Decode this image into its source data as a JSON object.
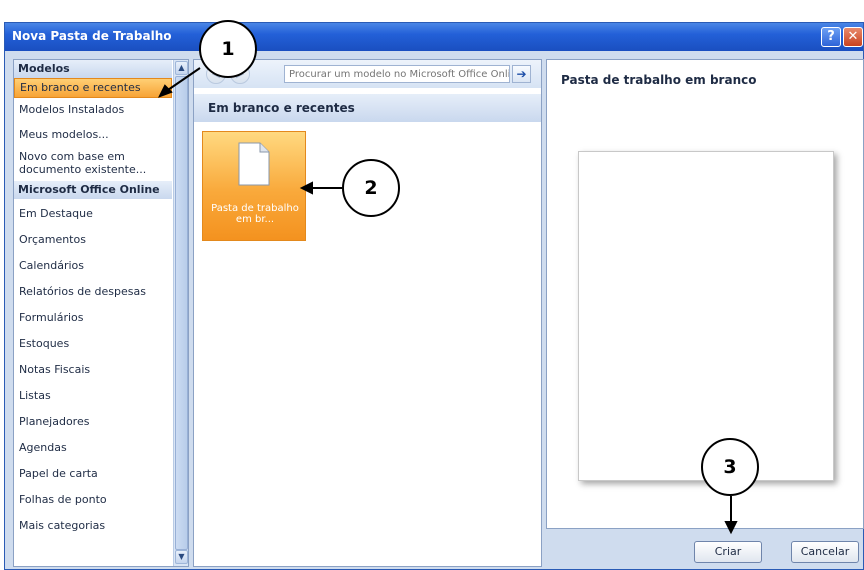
{
  "window": {
    "title": "Nova Pasta de Trabalho",
    "help_icon": "help-icon",
    "close_icon": "close-icon",
    "help_label": "?",
    "close_label": "✕"
  },
  "left_pane": {
    "heading_models": "Modelos",
    "items_top": [
      "Em branco e recentes",
      "Modelos Instalados",
      "Meus modelos...",
      "Novo com base em documento existente..."
    ],
    "heading_online": "Microsoft Office Online",
    "items_online": [
      "Em Destaque",
      "Orçamentos",
      "Calendários",
      "Relatórios de despesas",
      "Formulários",
      "Estoques",
      "Notas Fiscais",
      "Listas",
      "Planejadores",
      "Agendas",
      "Papel de carta",
      "Folhas de ponto",
      "Mais categorias"
    ],
    "selected_item": "Em branco e recentes"
  },
  "middle_pane": {
    "search_placeholder": "Procurar um modelo no Microsoft Office Online",
    "section_title": "Em branco e recentes",
    "tile_label": "Pasta de trabalho em br..."
  },
  "right_pane": {
    "preview_title": "Pasta de trabalho em branco"
  },
  "buttons": {
    "create": "Criar",
    "cancel": "Cancelar"
  },
  "callouts": [
    "1",
    "2",
    "3"
  ],
  "colors": {
    "title_bar": "#2360d8",
    "selection": "#f7a336",
    "pane_bg": "#cfdcee"
  }
}
